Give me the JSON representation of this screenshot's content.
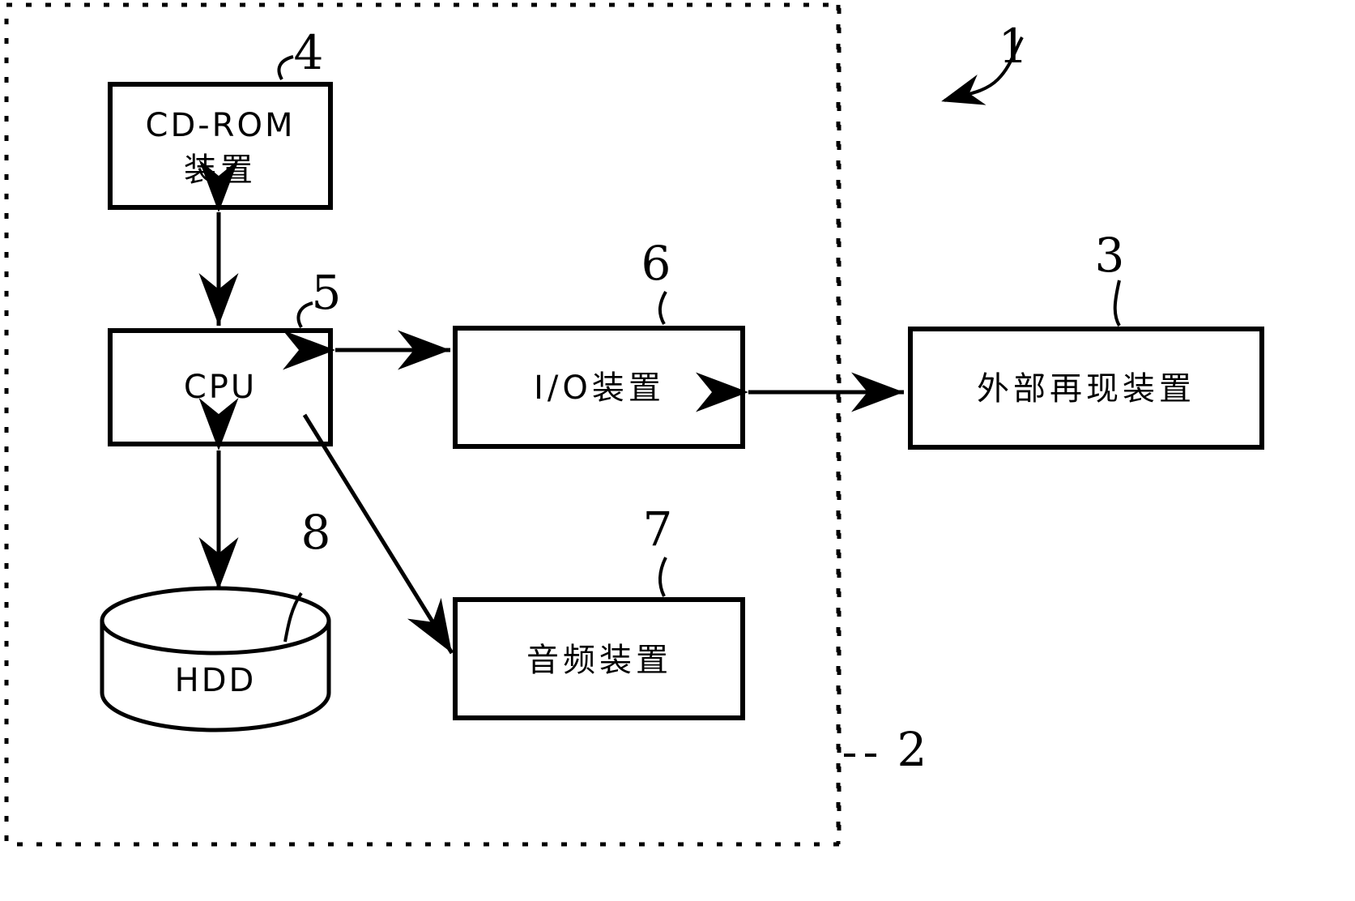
{
  "figure": {
    "type": "patent-block-diagram",
    "background_color": "#ffffff",
    "line_color": "#000000",
    "system_label": "1",
    "inner_unit_label": "2"
  },
  "boxes": {
    "cdrom": {
      "line1": "CD-ROM",
      "line2": "装置",
      "ref": "4"
    },
    "cpu": {
      "line1": "CPU",
      "ref": "5"
    },
    "io": {
      "line1": "I/O装置",
      "ref": "6"
    },
    "audio": {
      "line1": "音频装置",
      "ref": "7"
    },
    "external": {
      "line1": "外部再现装置",
      "ref": "3"
    },
    "hdd": {
      "line1": "HDD",
      "ref": "8"
    }
  },
  "reference_numerals": {
    "system": "1",
    "computer_unit": "2",
    "external_device": "3",
    "cdrom_device": "4",
    "cpu": "5",
    "io_device": "6",
    "audio_device": "7",
    "hdd": "8"
  },
  "connections": [
    {
      "from": "cpu",
      "to": "cdrom",
      "style": "double-arrow",
      "orientation": "vertical"
    },
    {
      "from": "cpu",
      "to": "io",
      "style": "double-arrow",
      "orientation": "horizontal"
    },
    {
      "from": "io",
      "to": "external",
      "style": "double-arrow",
      "orientation": "horizontal"
    },
    {
      "from": "cpu",
      "to": "hdd",
      "style": "double-arrow",
      "orientation": "vertical"
    },
    {
      "from": "cpu",
      "to": "audio",
      "style": "single-arrow",
      "orientation": "diagonal"
    }
  ]
}
